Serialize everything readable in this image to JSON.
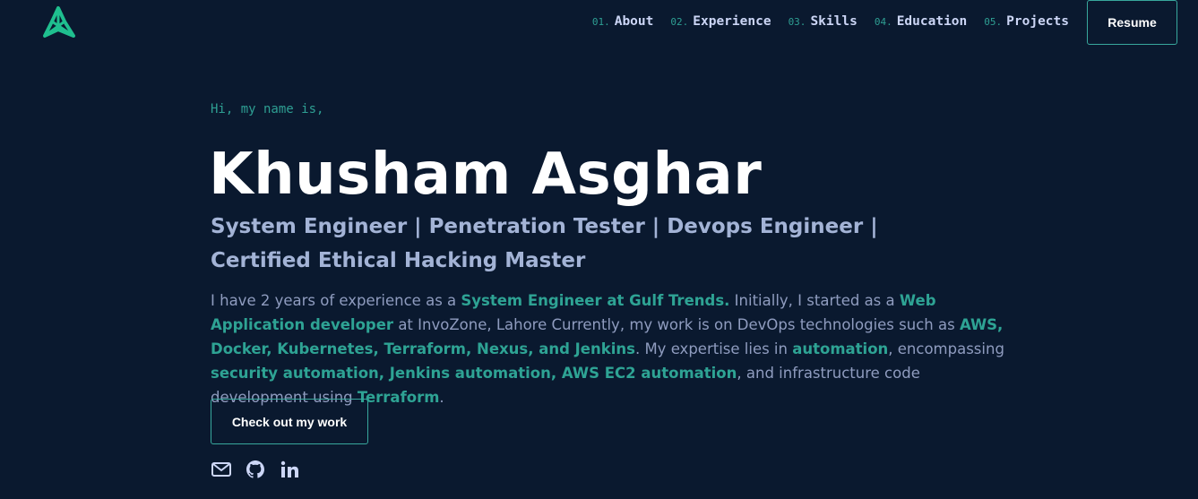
{
  "header": {
    "logo_icon": "star-logo-icon",
    "nav": [
      {
        "num": "01.",
        "label": "About"
      },
      {
        "num": "02.",
        "label": "Experience"
      },
      {
        "num": "03.",
        "label": "Skills"
      },
      {
        "num": "04.",
        "label": "Education"
      },
      {
        "num": "05.",
        "label": "Projects"
      }
    ],
    "resume_label": "Resume"
  },
  "hero": {
    "greeting": "Hi, my name is,",
    "name": "Khusham Asghar",
    "subtitle": "System Engineer | Penetration Tester | Devops Engineer | Certified Ethical Hacking Master",
    "bio": [
      {
        "text": "I have 2 years of experience as a ",
        "hl": false
      },
      {
        "text": "System Engineer at Gulf Trends.",
        "hl": true
      },
      {
        "text": " Initially, I started as a ",
        "hl": false
      },
      {
        "text": "Web Application developer",
        "hl": true
      },
      {
        "text": " at InvoZone, Lahore Currently, my work is on DevOps technologies such as ",
        "hl": false
      },
      {
        "text": "AWS, Docker, Kubernetes, Terraform, Nexus, and Jenkins",
        "hl": true
      },
      {
        "text": ". My expertise lies in ",
        "hl": false
      },
      {
        "text": "automation",
        "hl": true
      },
      {
        "text": ", encompassing ",
        "hl": false
      },
      {
        "text": "security automation, Jenkins automation, AWS EC2 automation",
        "hl": true
      },
      {
        "text": ", and infrastructure code development using ",
        "hl": false
      },
      {
        "text": "Terraform",
        "hl": true
      },
      {
        "text": ".",
        "hl": false
      }
    ],
    "cta_label": "Check out my work",
    "socials": [
      "mail-icon",
      "github-icon",
      "linkedin-icon"
    ]
  },
  "colors": {
    "background": "#0a192f",
    "accent": "#2e9f93",
    "heading": "#ffffff",
    "subtitle": "#a3b3d6",
    "body": "#8f9cbf"
  }
}
